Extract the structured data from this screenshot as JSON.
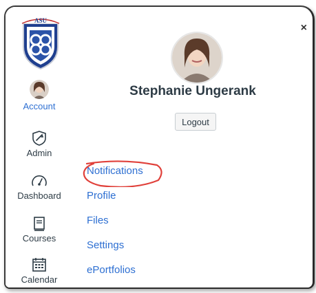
{
  "logo": {
    "text": "ASU"
  },
  "sidebar": {
    "items": [
      {
        "label": "Account"
      },
      {
        "label": "Admin"
      },
      {
        "label": "Dashboard"
      },
      {
        "label": "Courses"
      },
      {
        "label": "Calendar"
      }
    ]
  },
  "profile": {
    "name": "Stephanie Ungerank",
    "logout_label": "Logout",
    "close_label": "×"
  },
  "links": [
    {
      "label": "Notifications"
    },
    {
      "label": "Profile"
    },
    {
      "label": "Files"
    },
    {
      "label": "Settings"
    },
    {
      "label": "ePortfolios"
    }
  ],
  "colors": {
    "link": "#2d6fd2",
    "highlight": "#e0403a",
    "text": "#2d3b45"
  }
}
